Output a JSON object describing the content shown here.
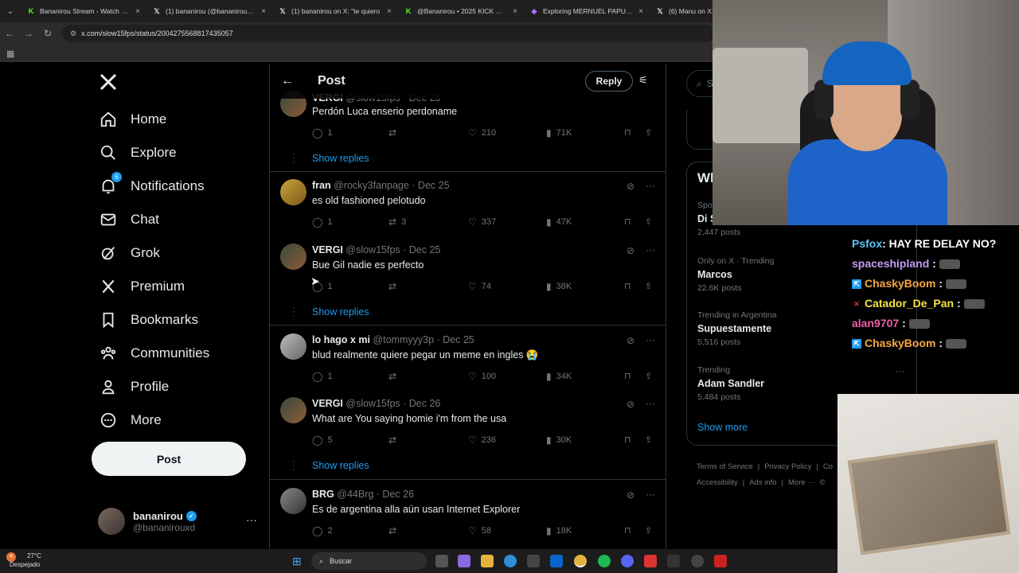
{
  "browser": {
    "tabs": [
      {
        "title": "Bananirou Stream - Watch Live",
        "favicon": "kick-icon"
      },
      {
        "title": "(1) bananirou (@bananirouxd) /",
        "favicon": "x-icon"
      },
      {
        "title": "(1) bananirou on X: \"te quiero",
        "favicon": "x-icon"
      },
      {
        "title": "@Bananirou • 2025 KICK WRAP",
        "favicon": "kick-icon"
      },
      {
        "title": "Exploring MERNUEL PAPU: Twi",
        "favicon": "twitch-icon"
      },
      {
        "title": "(6) Manu on X: \"",
        "favicon": "x-icon"
      }
    ],
    "url": "x.com/slow15fps/status/2004275568817435057"
  },
  "nav": {
    "items": [
      {
        "label": "Home",
        "icon": "home-icon"
      },
      {
        "label": "Explore",
        "icon": "search-icon"
      },
      {
        "label": "Notifications",
        "icon": "bell-icon",
        "badge": "6"
      },
      {
        "label": "Chat",
        "icon": "mail-icon"
      },
      {
        "label": "Grok",
        "icon": "grok-icon"
      },
      {
        "label": "Premium",
        "icon": "x-logo-icon"
      },
      {
        "label": "Bookmarks",
        "icon": "bookmark-icon"
      },
      {
        "label": "Communities",
        "icon": "people-icon"
      },
      {
        "label": "Profile",
        "icon": "person-icon"
      },
      {
        "label": "More",
        "icon": "more-circle-icon"
      }
    ],
    "post_label": "Post",
    "account": {
      "name": "bananirou",
      "handle": "@bananirouxd"
    }
  },
  "header": {
    "title": "Post",
    "reply_label": "Reply"
  },
  "tweets": [
    {
      "name": "VERGI",
      "handle": "@slow15fps",
      "date": "Dec 25",
      "text": "Perdón Luca enserio perdoname",
      "replies": "1",
      "reposts": "",
      "likes": "210",
      "views": "71K",
      "show_replies": "Show replies"
    },
    {
      "name": "fran",
      "handle": "@rocky3fanpage",
      "date": "Dec 25",
      "text": "es old fashioned pelotudo",
      "replies": "1",
      "reposts": "3",
      "likes": "337",
      "views": "47K",
      "show_replies": ""
    },
    {
      "name": "VERGI",
      "handle": "@slow15fps",
      "date": "Dec 25",
      "text": "Bue Gil nadie es perfecto",
      "replies": "1",
      "reposts": "",
      "likes": "74",
      "views": "38K",
      "show_replies": "Show replies"
    },
    {
      "name": "lo hago x mi",
      "handle": "@tommyyy3p",
      "date": "Dec 25",
      "text": "blud realmente quiere pegar un meme en ingles 😭",
      "replies": "1",
      "reposts": "",
      "likes": "100",
      "views": "34K",
      "show_replies": ""
    },
    {
      "name": "VERGI",
      "handle": "@slow15fps",
      "date": "Dec 26",
      "text": "What are You saying homie i'm from the usa",
      "replies": "5",
      "reposts": "",
      "likes": "236",
      "views": "30K",
      "show_replies": "Show replies"
    },
    {
      "name": "BRG",
      "handle": "@44Brg",
      "date": "Dec 26",
      "text": "Es de argentina alla aún usan Internet Explorer",
      "replies": "2",
      "reposts": "",
      "likes": "58",
      "views": "18K",
      "show_replies": ""
    }
  ],
  "right": {
    "search_placeholder": "S",
    "trends_title": "Wh",
    "trends": [
      {
        "category": "Spo",
        "name": "Di S",
        "count": "2,447 posts"
      },
      {
        "category": "Only on X · Trending",
        "name": "Marcos",
        "count": "22.6K posts"
      },
      {
        "category": "Trending in Argentina",
        "name": "Supuestamente",
        "count": "5,516 posts"
      },
      {
        "category": "Trending",
        "name": "Adam Sandler",
        "count": "5,484 posts"
      }
    ],
    "show_more": "Show more",
    "footer": [
      "Terms of Service",
      "|",
      "Privacy Policy",
      "|",
      "Co",
      "Accessibility",
      "|",
      "Ads info",
      "|",
      "More ···",
      "©"
    ]
  },
  "chat": [
    {
      "user": "Psfox",
      "msg": ": HAY RE DELAY NO?",
      "user_color": "#5ec4f5"
    },
    {
      "user": "spaceshipland",
      "msg": ":",
      "user_color": "#c79bf2"
    },
    {
      "user": "ChaskyBoom",
      "msg": ":",
      "user_color": "#f5a742"
    },
    {
      "user": "Catador_De_Pan",
      "msg": ":",
      "user_color": "#f5e342"
    },
    {
      "user": "alan9707",
      "msg": ":",
      "user_color": "#f25caa"
    },
    {
      "user": "ChaskyBoom",
      "msg": ":",
      "user_color": "#f5a742"
    }
  ],
  "taskbar": {
    "temp": "27°C",
    "weather": "Despejado",
    "search": "Buscar"
  },
  "colors": {
    "accent": "#1d9bf0",
    "background": "#000000",
    "border": "#2f3336",
    "muted": "#71767b"
  }
}
